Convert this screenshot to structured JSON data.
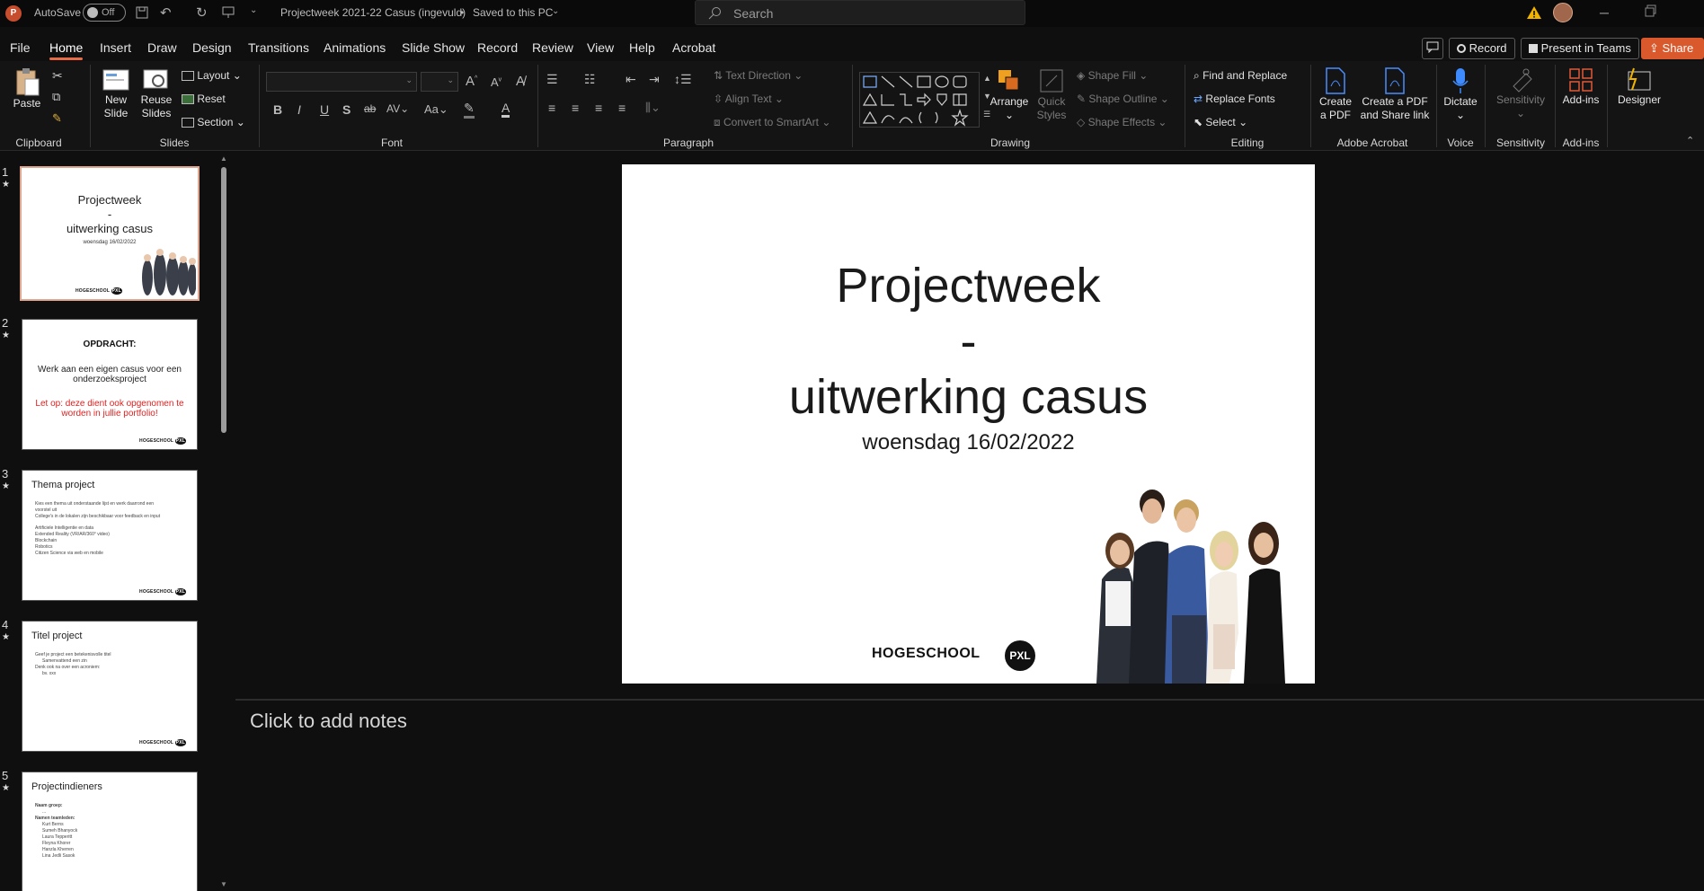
{
  "titlebar": {
    "autosave_label": "AutoSave",
    "autosave_state": "Off",
    "document_title": "Projectweek 2021-22 Casus (ingevuld)",
    "save_status": "Saved to this PC",
    "search_placeholder": "Search"
  },
  "menu": {
    "tabs": [
      "File",
      "Home",
      "Insert",
      "Draw",
      "Design",
      "Transitions",
      "Animations",
      "Slide Show",
      "Record",
      "Review",
      "View",
      "Help",
      "Acrobat"
    ],
    "active_tab": "Home",
    "record_button": "Record",
    "present_button": "Present in Teams",
    "share_button": "Share"
  },
  "ribbon": {
    "clipboard": {
      "paste": "Paste",
      "label": "Clipboard"
    },
    "slides": {
      "new_slide_1": "New",
      "new_slide_2": "Slide",
      "reuse_1": "Reuse",
      "reuse_2": "Slides",
      "layout": "Layout",
      "reset": "Reset",
      "section": "Section",
      "label": "Slides"
    },
    "font": {
      "label": "Font"
    },
    "paragraph": {
      "text_direction": "Text Direction",
      "align_text": "Align Text",
      "smartart": "Convert to SmartArt",
      "label": "Paragraph"
    },
    "drawing": {
      "arrange": "Arrange",
      "quick_1": "Quick",
      "quick_2": "Styles",
      "shape_fill": "Shape Fill",
      "shape_outline": "Shape Outline",
      "shape_effects": "Shape Effects",
      "label": "Drawing"
    },
    "editing": {
      "find": "Find and Replace",
      "replace_fonts": "Replace Fonts",
      "select": "Select",
      "label": "Editing"
    },
    "acrobat": {
      "create_1": "Create",
      "create_2": "a PDF",
      "share_1": "Create a PDF",
      "share_2": "and Share link",
      "label": "Adobe Acrobat"
    },
    "voice": {
      "dictate": "Dictate",
      "label": "Voice"
    },
    "sensitivity": {
      "button": "Sensitivity",
      "label": "Sensitivity"
    },
    "addins": {
      "button": "Add-ins",
      "label": "Add-ins"
    },
    "designer": {
      "button": "Designer"
    }
  },
  "thumbnails": [
    {
      "num": "1",
      "title_1": "Projectweek",
      "title_2": "-",
      "title_3": "uitwerking casus",
      "date": "woensdag 16/02/2022"
    },
    {
      "num": "2",
      "heading": "OPDRACHT:",
      "body": "Werk aan een eigen casus voor een onderzoeksproject",
      "note": "Let op: deze dient ook opgenomen te worden in jullie portfolio!"
    },
    {
      "num": "3",
      "title": "Thema project",
      "lines": [
        "Kies een thema uit onderstaande lijst en werk daarrond een voorstel uit",
        "College's in de lokalen zijn beschikbaar voor feedback en input",
        "",
        "Artificiele Intelligentie en data",
        "Extended Reality (VR/AR/360° video)",
        "Blockchain",
        "Robotics",
        "Citizen Science via web en mobile"
      ]
    },
    {
      "num": "4",
      "title": "Titel project",
      "lines": [
        "Geef je project een betekenisvolle titel",
        "Samenvattend een zin",
        "Denk ook na over een acroniem:",
        "bv. xxx"
      ]
    },
    {
      "num": "5",
      "title": "Projectindieners",
      "lines": [
        "Naam groep:",
        "...",
        "Namen teamleden:",
        "Kurt Berns",
        "Sumeh Bhanyock",
        "Laura Tepperitt",
        "Fleyna Khorer",
        "Hanzla Kherren",
        "Lina Jedli Sasok"
      ]
    }
  ],
  "logo_text": "HOGESCHOOL",
  "logo_badge": "PXL",
  "slide": {
    "title_line1": "Projectweek",
    "title_line2": "-",
    "title_line3": "uitwerking casus",
    "subtitle": "woensdag 16/02/2022"
  },
  "notes": {
    "placeholder": "Click to add notes"
  },
  "colors": {
    "accent": "#e66b47",
    "share": "#d9592d",
    "background": "#0f0f0f"
  }
}
